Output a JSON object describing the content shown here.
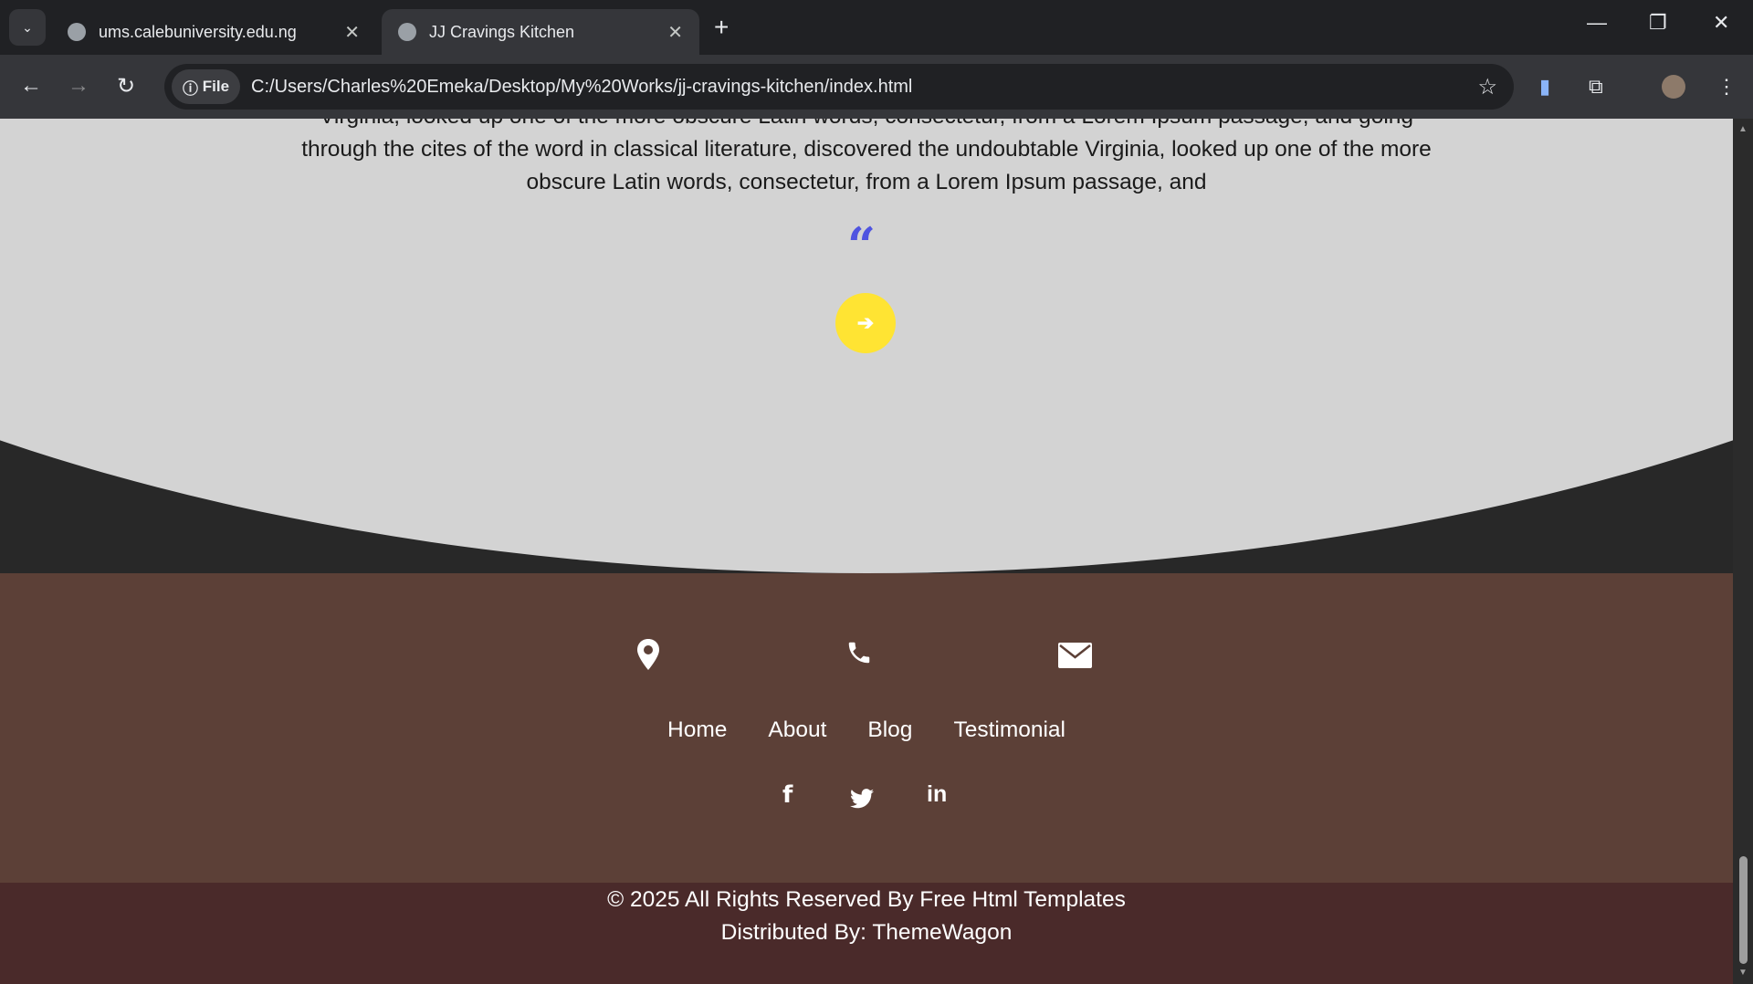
{
  "browser": {
    "tabs": [
      {
        "title": "ums.calebuniversity.edu.ng",
        "active": false
      },
      {
        "title": "JJ Cravings Kitchen",
        "active": true
      }
    ],
    "address": {
      "chip": "File",
      "url": "C:/Users/Charles%20Emeka/Desktop/My%20Works/jj-cravings-kitchen/index.html"
    }
  },
  "testimonial": {
    "lines": [
      "Virginia, looked up one of the more obscure Latin words, consectetur, from a Lorem Ipsum passage, and going",
      "through the cites of the word in classical literature, discovered the undoubtable Virginia, looked up one of the more",
      "obscure Latin words, consectetur, from a Lorem Ipsum passage, and"
    ],
    "quote_icon": "quote-left-icon",
    "next_icon": "arrow-right-icon"
  },
  "footer": {
    "contact_icons": [
      "map-marker-icon",
      "phone-icon",
      "envelope-icon"
    ],
    "links": [
      "Home",
      "About",
      "Blog",
      "Testimonial"
    ],
    "social": [
      "facebook-icon",
      "twitter-icon",
      "linkedin-icon"
    ],
    "copyright": "© 2025 All Rights Reserved By Free Html Templates",
    "distributed": "Distributed By: ThemeWagon"
  },
  "colors": {
    "accent_blue": "#4f54e0",
    "button_yellow": "#ffe433",
    "footer": "#5c4037",
    "bottom_bar": "#4a2a2a"
  }
}
